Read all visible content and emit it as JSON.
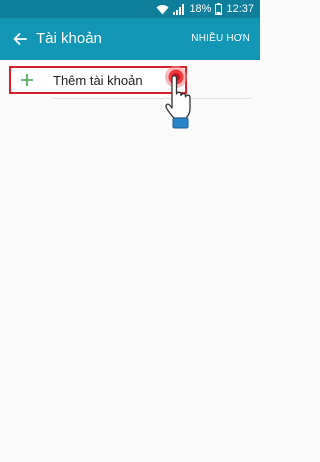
{
  "status_bar": {
    "battery_percent": "18%",
    "time": "12:37",
    "icons": [
      "wifi-icon",
      "signal-icon",
      "battery-icon"
    ]
  },
  "app_bar": {
    "back_icon": "arrow-left-icon",
    "title": "Tài khoản",
    "more_label": "NHIỀU HƠN"
  },
  "accounts": {
    "add_account_label": "Thêm tài khoản",
    "add_icon": "plus-icon",
    "highlight_color": "#d9202a"
  },
  "colors": {
    "status_bar": "#0d7f9b",
    "app_bar": "#1296b6",
    "plus": "#3ea84a",
    "background": "#fafafa"
  }
}
